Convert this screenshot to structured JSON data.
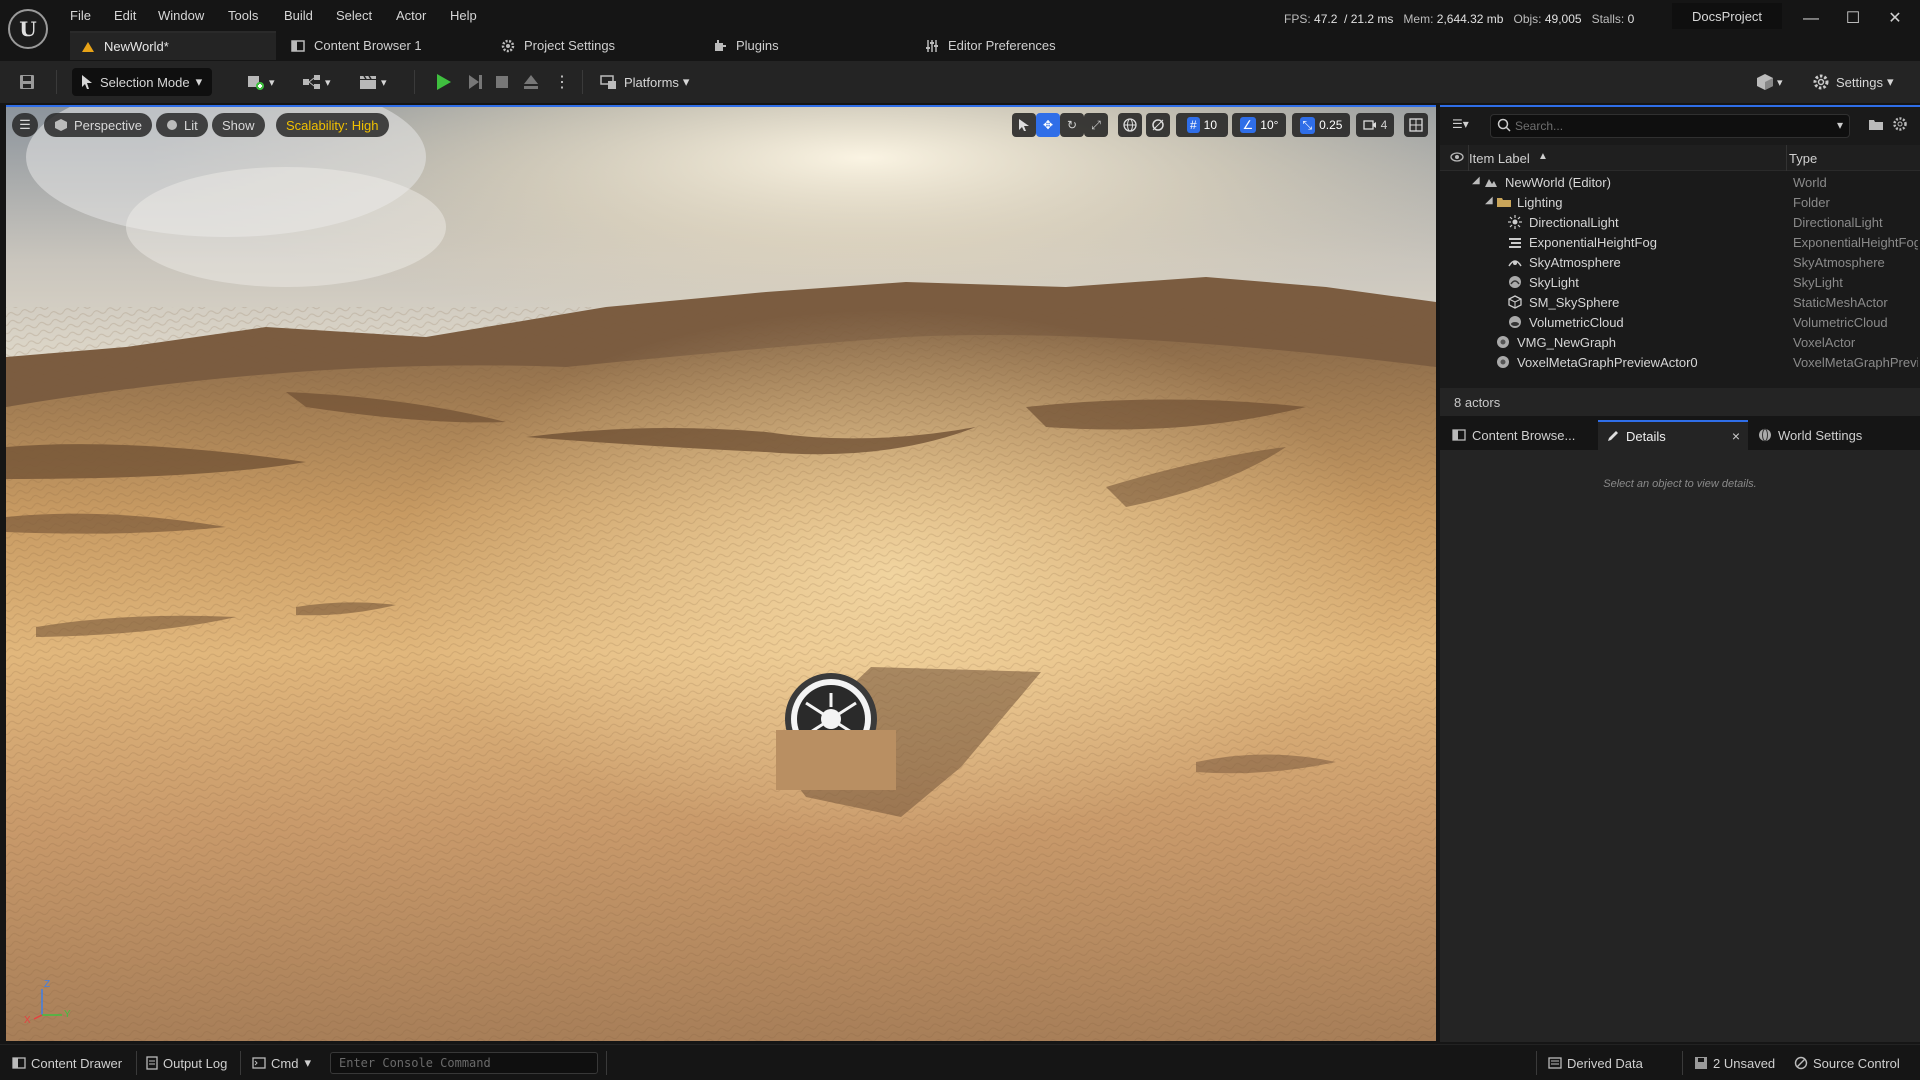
{
  "menu": [
    "File",
    "Edit",
    "Window",
    "Tools",
    "Build",
    "Select",
    "Actor",
    "Help"
  ],
  "stats": {
    "fps_label": "FPS:",
    "fps": "47.2",
    "ms": "/ 21.2 ms",
    "mem_label": "Mem:",
    "mem": "2,644.32 mb",
    "objs_label": "Objs:",
    "objs": "49,005",
    "stalls_label": "Stalls:",
    "stalls": "0"
  },
  "project": "DocsProject",
  "window_controls": {
    "minimize": "—",
    "maximize": "☐",
    "close": "✕"
  },
  "tabs": [
    {
      "label": "NewWorld*",
      "icon": "level-icon"
    },
    {
      "label": "Content Browser 1",
      "icon": "content-browser-icon"
    },
    {
      "label": "Project Settings",
      "icon": "gears-icon"
    },
    {
      "label": "Plugins",
      "icon": "plugin-icon"
    },
    {
      "label": "Editor Preferences",
      "icon": "sliders-icon"
    }
  ],
  "toolbar": {
    "selection_mode": "Selection Mode",
    "platforms": "Platforms",
    "settings": "Settings"
  },
  "viewport": {
    "perspective": "Perspective",
    "lit": "Lit",
    "show": "Show",
    "scalability": "Scalability: High",
    "grid_snap": "10",
    "rotation_snap": "10°",
    "scale_snap": "0.25",
    "camera_speed": "4",
    "axis_z": "Z",
    "axis_y": "Y",
    "axis_x": "X"
  },
  "outliner": {
    "search_placeholder": "Search...",
    "col_label": "Item Label",
    "col_type": "Type",
    "rows": [
      {
        "label": "NewWorld (Editor)",
        "type": "World"
      },
      {
        "label": "Lighting",
        "type": "Folder"
      },
      {
        "label": "DirectionalLight",
        "type": "DirectionalLight"
      },
      {
        "label": "ExponentialHeightFog",
        "type": "ExponentialHeightFog"
      },
      {
        "label": "SkyAtmosphere",
        "type": "SkyAtmosphere"
      },
      {
        "label": "SkyLight",
        "type": "SkyLight"
      },
      {
        "label": "SM_SkySphere",
        "type": "StaticMeshActor"
      },
      {
        "label": "VolumetricCloud",
        "type": "VolumetricCloud"
      },
      {
        "label": "VMG_NewGraph",
        "type": "VoxelActor"
      },
      {
        "label": "VoxelMetaGraphPreviewActor0",
        "type": "VoxelMetaGraphPreviewActor"
      }
    ],
    "actor_count": "8 actors"
  },
  "detail_tabs": {
    "content_browser": "Content Browse...",
    "details": "Details",
    "world_settings": "World Settings",
    "close": "×"
  },
  "details_hint": "Select an object to view details.",
  "statusbar": {
    "content_drawer": "Content Drawer",
    "output_log": "Output Log",
    "cmd": "Cmd",
    "console_placeholder": "Enter Console Command",
    "derived_data": "Derived Data",
    "unsaved": "2 Unsaved",
    "source_control": "Source Control"
  },
  "colors": {
    "accent_blue": "#2f6ee8",
    "play_green": "#3fbf3f",
    "scalability_yellow": "#f0c000"
  }
}
